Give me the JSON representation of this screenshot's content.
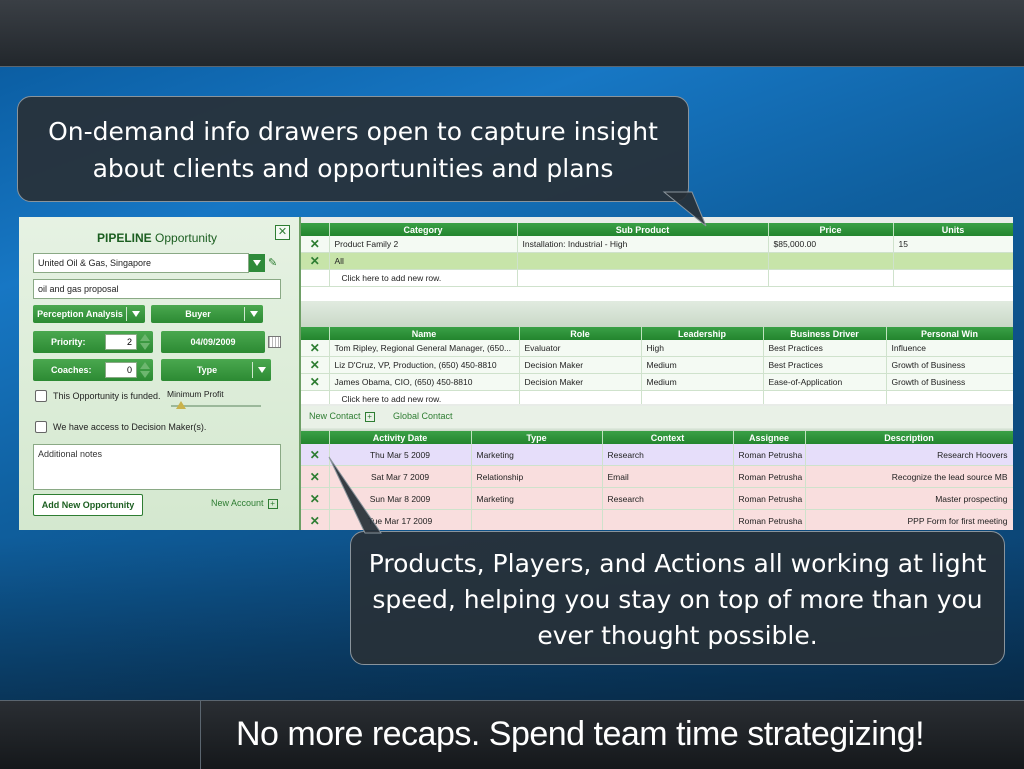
{
  "callout_top": {
    "line1": "On-demand info drawers open to capture insight",
    "line2": "about clients and opportunities and plans"
  },
  "callout_bottom": {
    "line1": "Products, Players, and Actions all working at light",
    "line2": "speed, helping you stay on top of more than you",
    "line3": "ever thought possible."
  },
  "bottom_caption": "No more recaps.  Spend team time strategizing!",
  "panel": {
    "title_bold": "PIPELINE",
    "title_rest": " Opportunity",
    "account": "United Oil & Gas, Singapore",
    "opportunity_name": "oil and gas proposal",
    "perception_label": "Perception Analysis",
    "buyer_label": "Buyer",
    "priority_label": "Priority:",
    "priority_value": "2",
    "date_value": "04/09/2009",
    "coaches_label": "Coaches:",
    "coaches_value": "0",
    "type_label": "Type",
    "funded_label": "This Opportunity is funded.",
    "min_profit_label": "Minimum Profit",
    "access_label": "We have access to Decision Maker(s).",
    "notes_placeholder": "Additional notes",
    "add_button": "Add New Opportunity",
    "new_account": "New Account"
  },
  "products": {
    "headers": [
      "Category",
      "Sub Product",
      "Price",
      "Units"
    ],
    "rows": [
      {
        "category": "Product Family 2",
        "sub": "Installation: Industrial - High",
        "price": "$85,000.00",
        "units": "15"
      },
      {
        "category": "All",
        "sub": "",
        "price": "",
        "units": ""
      }
    ],
    "add_row": "Click here to add new row."
  },
  "players": {
    "headers": [
      "Name",
      "Role",
      "Leadership",
      "Business Driver",
      "Personal Win"
    ],
    "rows": [
      {
        "name": "Tom Ripley, Regional General Manager, (650...",
        "role": "Evaluator",
        "leadership": "High",
        "driver": "Best Practices",
        "win": "Influence"
      },
      {
        "name": "Liz D'Cruz, VP, Production, (650) 450-8810",
        "role": "Decision Maker",
        "leadership": "Medium",
        "driver": "Best Practices",
        "win": "Growth of Business"
      },
      {
        "name": "James Obama, CIO, (650) 450-8810",
        "role": "Decision Maker",
        "leadership": "Medium",
        "driver": "Ease-of-Application",
        "win": "Growth of Business"
      }
    ],
    "add_row": "Click here to add new row.",
    "new_contact": "New Contact",
    "global_contact": "Global Contact"
  },
  "activities": {
    "headers": [
      "Activity Date",
      "Type",
      "Context",
      "Assignee",
      "Description"
    ],
    "rows": [
      {
        "date": "Thu Mar 5 2009",
        "type": "Marketing",
        "context": "Research",
        "assignee": "Roman Petrusha",
        "desc": "Research Hoovers"
      },
      {
        "date": "Sat Mar 7 2009",
        "type": "Relationship",
        "context": "Email",
        "assignee": "Roman Petrusha",
        "desc": "Recognize the lead source MB"
      },
      {
        "date": "Sun Mar 8 2009",
        "type": "Marketing",
        "context": "Research",
        "assignee": "Roman Petrusha",
        "desc": "Master prospecting"
      },
      {
        "date": "Tue Mar 17 2009",
        "type": "",
        "context": "",
        "assignee": "Roman Petrusha",
        "desc": "PPP Form for first meeting"
      }
    ]
  }
}
